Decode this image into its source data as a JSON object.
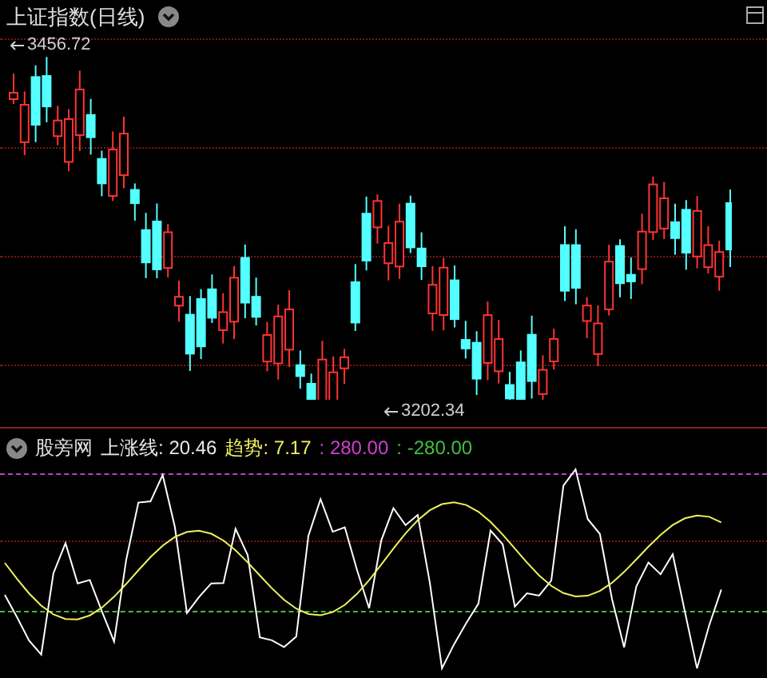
{
  "main_panel": {
    "title": "上证指数(日线)",
    "high_label": "3456.72",
    "low_label": "3202.34"
  },
  "indicator_panel": {
    "name": "股旁网",
    "legend": [
      {
        "label": "上涨线:",
        "value": "20.46",
        "color": "#e8e8e8"
      },
      {
        "label": "趋势:",
        "value": "7.17",
        "color": "#f0f060"
      },
      {
        "label": ":",
        "value": "280.00",
        "color": "#d040d0"
      },
      {
        "label": ":",
        "value": "-280.00",
        "color": "#40c040"
      }
    ]
  }
}
